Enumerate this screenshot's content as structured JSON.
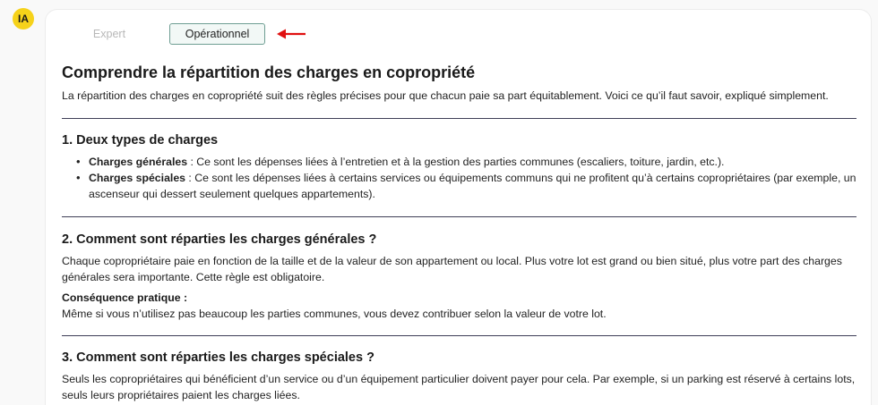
{
  "avatar": {
    "label": "IA"
  },
  "tabs": [
    {
      "label": "Expert",
      "active": false
    },
    {
      "label": "Opérationnel",
      "active": true
    }
  ],
  "colors": {
    "accent_border": "#6e9e93",
    "arrow": "#e01010",
    "avatar_bg": "#f6d21a",
    "divider": "#3e3e56"
  },
  "article": {
    "title": "Comprendre la répartition des charges en copropriété",
    "intro": "La répartition des charges en copropriété suit des règles précises pour que chacun paie sa part équitablement. Voici ce qu’il faut savoir, expliqué simplement.",
    "section1": {
      "heading": "1. Deux types de charges",
      "items": [
        {
          "term": "Charges générales",
          "text": " : Ce sont les dépenses liées à l’entretien et à la gestion des parties communes (escaliers, toiture, jardin, etc.)."
        },
        {
          "term": "Charges spéciales",
          "text": " : Ce sont les dépenses liées à certains services ou équipements communs qui ne profitent qu’à certains copropriétaires (par exemple, un ascenseur qui dessert seulement quelques appartements)."
        }
      ]
    },
    "section2": {
      "heading": "2. Comment sont réparties les charges générales ?",
      "body": "Chaque copropriétaire paie en fonction de la taille et de la valeur de son appartement ou local. Plus votre lot est grand ou bien situé, plus votre part des charges générales sera importante. Cette règle est obligatoire.",
      "consequence_label": "Conséquence pratique :",
      "consequence_text": "Même si vous n’utilisez pas beaucoup les parties communes, vous devez contribuer selon la valeur de votre lot."
    },
    "section3": {
      "heading": "3. Comment sont réparties les charges spéciales ?",
      "body": "Seuls les copropriétaires qui bénéficient d’un service ou d’un équipement particulier doivent payer pour cela. Par exemple, si un parking est réservé à certains lots, seuls leurs propriétaires paient les charges liées."
    }
  }
}
